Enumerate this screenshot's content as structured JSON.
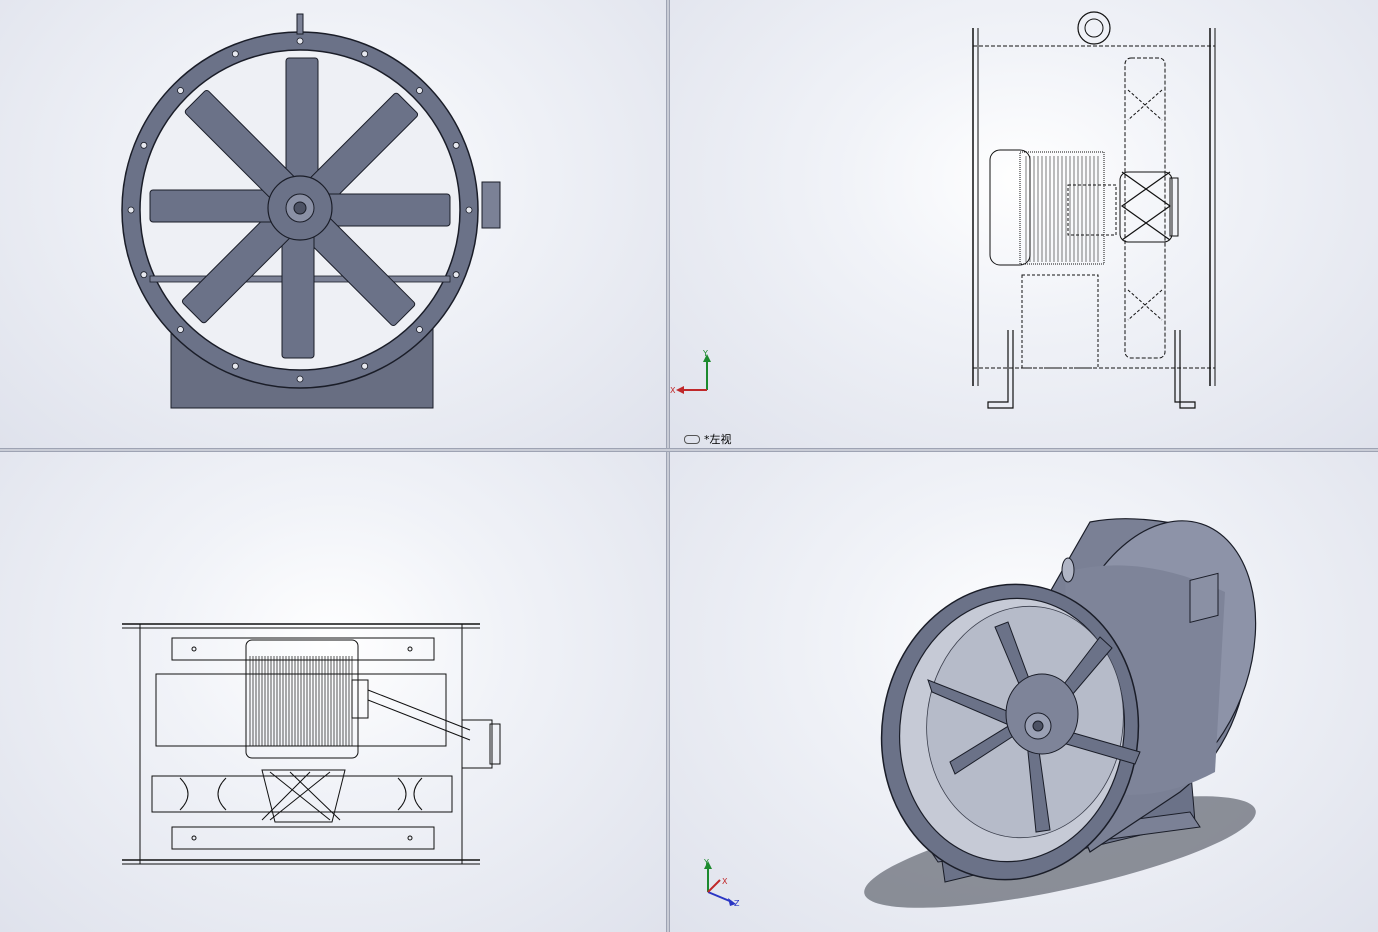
{
  "viewports": {
    "front": {
      "name": "front-view"
    },
    "left": {
      "name": "left-view",
      "label": "*左视"
    },
    "top": {
      "name": "top-view"
    },
    "iso": {
      "name": "isometric-view"
    }
  },
  "triad": {
    "x": "X",
    "y": "Y",
    "z": "Z"
  },
  "colors": {
    "metal": "#6b7288",
    "metal_light": "#a3a9bd",
    "edge": "#1a1d28",
    "background": "#e4e7ef"
  }
}
